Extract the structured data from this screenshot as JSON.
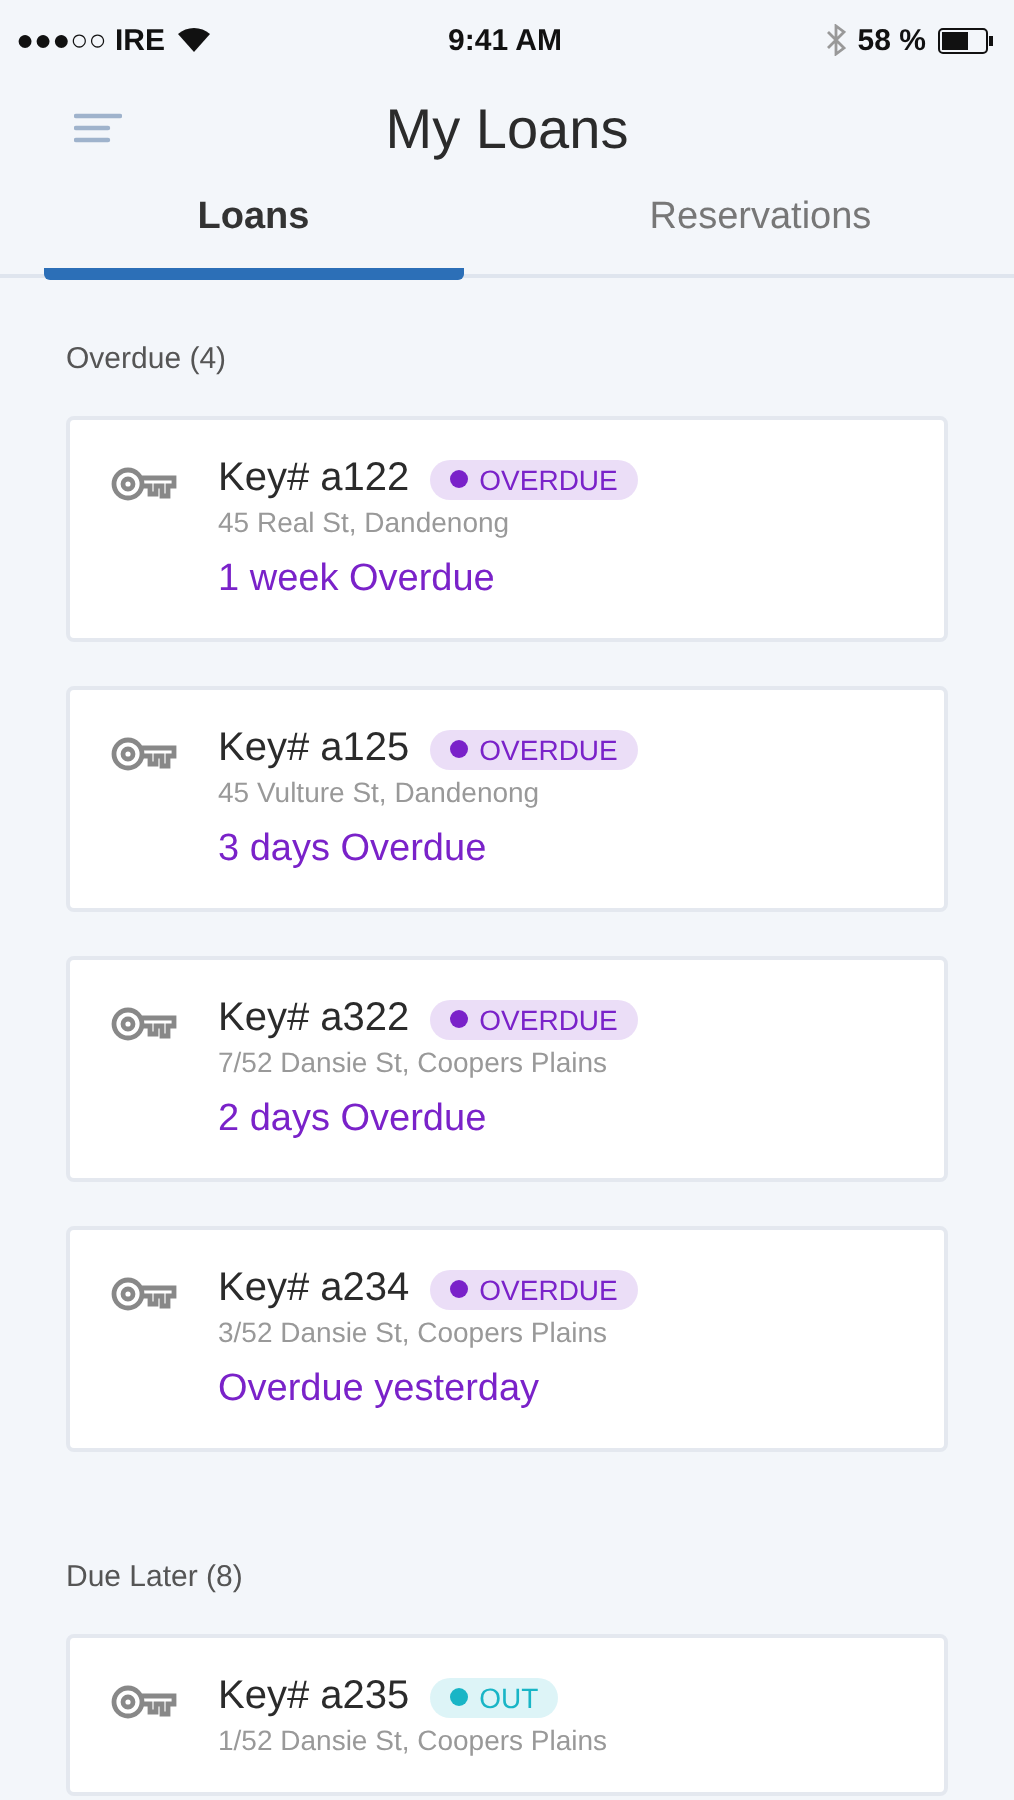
{
  "status_bar": {
    "carrier": "●●●○○ IRE",
    "time": "9:41 AM",
    "battery": "58 %"
  },
  "header": {
    "title": "My Loans"
  },
  "tabs": [
    {
      "label": "Loans",
      "selected": true
    },
    {
      "label": "Reservations",
      "selected": false
    }
  ],
  "sections": [
    {
      "title": "Overdue (4)",
      "loans": [
        {
          "key": "Key# a122",
          "status": "OVERDUE",
          "color": "#7a22c9",
          "address": "45 Real St, Dandenong",
          "due": "1 week Overdue"
        },
        {
          "key": "Key# a125",
          "status": "OVERDUE",
          "color": "#7a22c9",
          "address": "45 Vulture St, Dandenong",
          "due": "3 days Overdue"
        },
        {
          "key": "Key# a322",
          "status": "OVERDUE",
          "color": "#7a22c9",
          "address": "7/52 Dansie St, Coopers Plains",
          "due": "2 days Overdue"
        },
        {
          "key": "Key# a234",
          "status": "OVERDUE",
          "color": "#7a22c9",
          "address": "3/52 Dansie St, Coopers Plains",
          "due": "Overdue yesterday"
        }
      ]
    },
    {
      "title": "Due Later (8)",
      "loans": [
        {
          "key": "Key# a235",
          "status": "OUT",
          "color": "#19b5c6",
          "address": "1/52 Dansie St, Coopers Plains"
        }
      ]
    }
  ]
}
